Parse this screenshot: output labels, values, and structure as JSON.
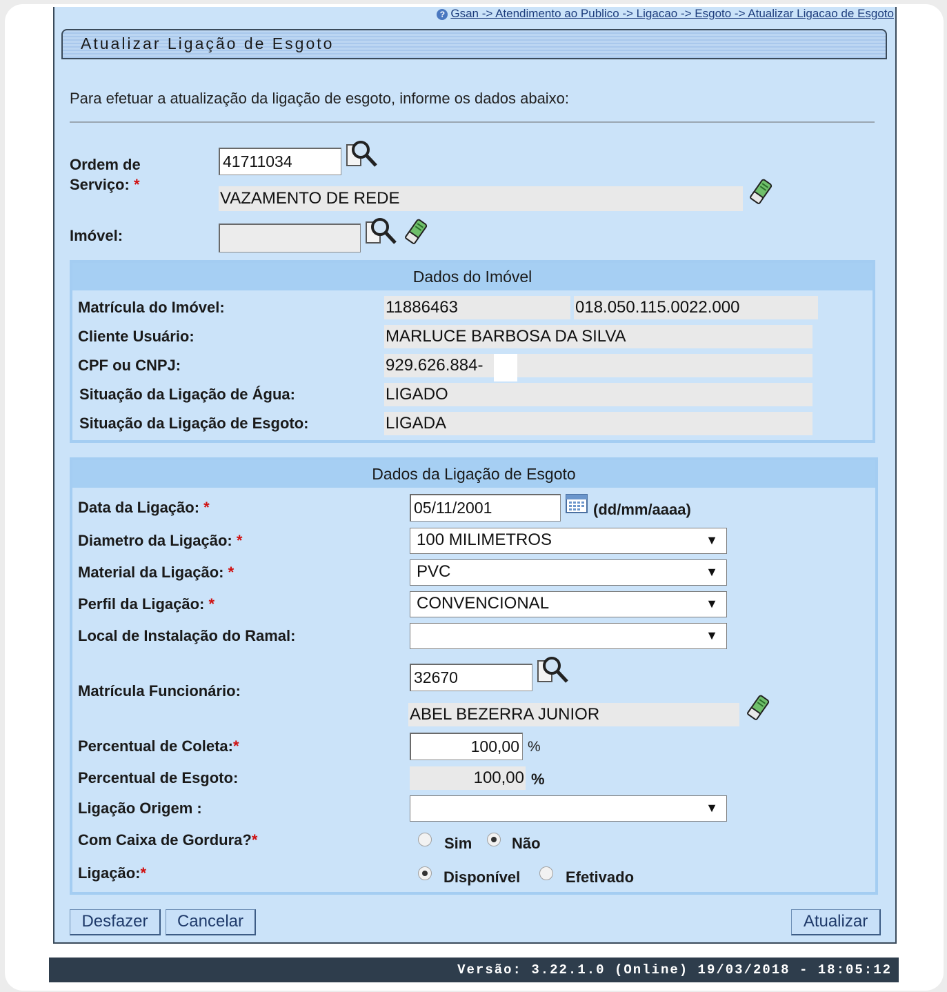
{
  "breadcrumb": {
    "help_icon": "help-icon",
    "text": "Gsan -> Atendimento ao Publico -> Ligacao -> Esgoto -> Atualizar Ligacao de Esgoto"
  },
  "title": "Atualizar Ligação de Esgoto",
  "intro": "Para efetuar a atualização da ligação de esgoto, informe os dados abaixo:",
  "ordem": {
    "label_line1": "Ordem de",
    "label_line2": "Serviço:",
    "required": "*",
    "value": "41711034",
    "description": "VAZAMENTO DE REDE"
  },
  "imovel": {
    "label": "Imóvel:",
    "value": ""
  },
  "dados_imovel": {
    "header": "Dados do Imóvel",
    "matricula_label": "Matrícula do Imóvel:",
    "matricula": "11886463",
    "inscricao": "018.050.115.0022.000",
    "cliente_label": "Cliente Usuário:",
    "cliente": "MARLUCE BARBOSA DA SILVA",
    "cpf_label": "CPF ou CNPJ:",
    "cpf": "929.626.884-",
    "sit_agua_label": "Situação da Ligação de Água:",
    "sit_agua": "LIGADO",
    "sit_esgoto_label": "Situação da Ligação de Esgoto:",
    "sit_esgoto": "LIGADA"
  },
  "dados_ligacao": {
    "header": "Dados da Ligação de Esgoto",
    "data_label": "Data da Ligação:",
    "data_value": "05/11/2001",
    "data_format": "(dd/mm/aaaa)",
    "diametro_label": "Diametro da Ligação:",
    "diametro_value": "100 MILIMETROS",
    "material_label": "Material da Ligação:",
    "material_value": "PVC",
    "perfil_label": "Perfil da Ligação:",
    "perfil_value": "CONVENCIONAL",
    "local_label": "Local de Instalação do Ramal:",
    "local_value": "",
    "func_label": "Matrícula Funcionário:",
    "func_value": "32670",
    "func_name": "ABEL BEZERRA JUNIOR",
    "coleta_label": "Percentual de Coleta:",
    "coleta_value": "100,00",
    "esgoto_label": "Percentual de Esgoto:",
    "esgoto_value": "100,00",
    "percent": "%",
    "origem_label": "Ligação Origem :",
    "origem_value": "",
    "gordura_label": "Com Caixa de Gordura?",
    "gordura_sim": "Sim",
    "gordura_nao": "Não",
    "gordura_selected": "Não",
    "ligacao_label": "Ligação:",
    "ligacao_disp": "Disponível",
    "ligacao_efet": "Efetivado",
    "ligacao_selected": "Disponível",
    "required": "*",
    "arrow": "▼"
  },
  "buttons": {
    "desfazer": "Desfazer",
    "cancelar": "Cancelar",
    "atualizar": "Atualizar"
  },
  "footer": "Versão: 3.22.1.0 (Online) 19/03/2018 - 18:05:12",
  "icons": {
    "search": "magnifier-search-icon",
    "clear": "eraser-clear-icon",
    "calendar": "calendar-icon"
  }
}
